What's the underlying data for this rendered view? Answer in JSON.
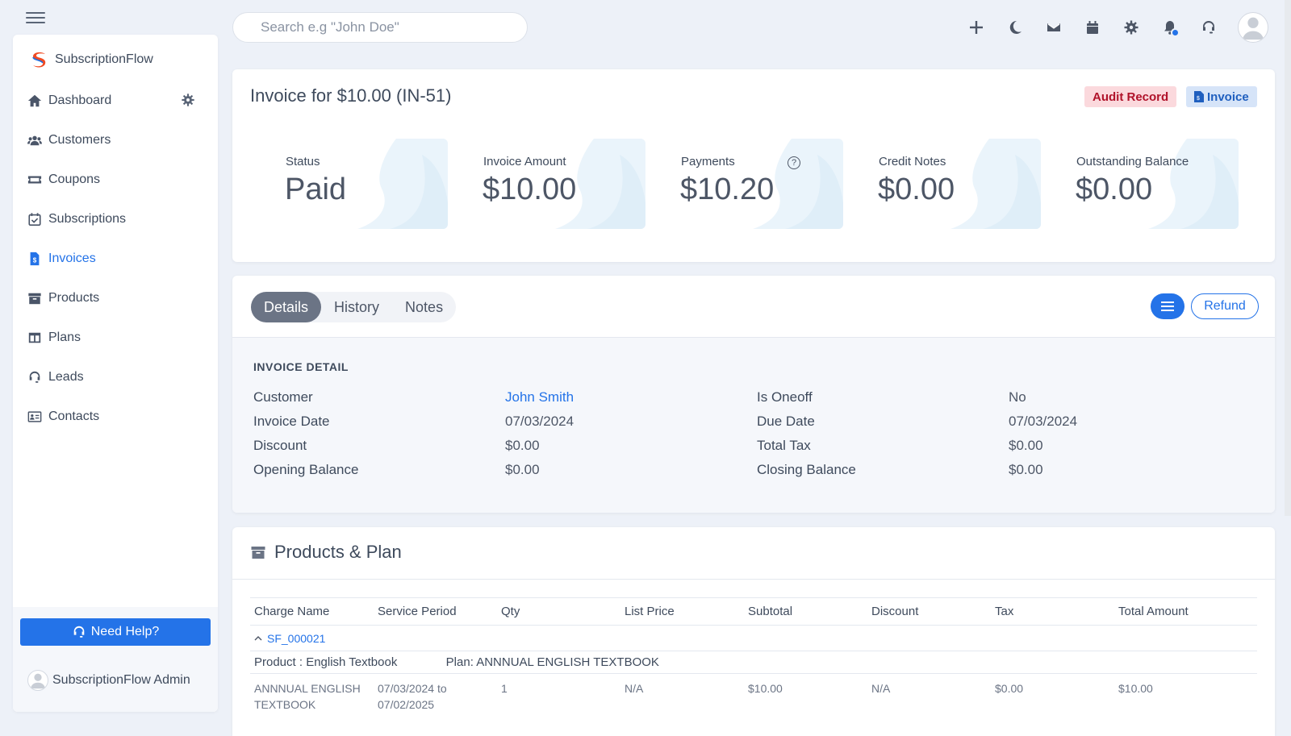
{
  "topbar": {
    "search_placeholder": "Search e.g \"John Doe\"",
    "icons": [
      "plus-icon",
      "moon-icon",
      "mail-icon",
      "calendar-icon",
      "gear-icon",
      "bell-icon",
      "headset-icon",
      "avatar"
    ]
  },
  "sidebar": {
    "brand": "SubscriptionFlow",
    "items": [
      {
        "label": "Dashboard",
        "icon": "home-icon"
      },
      {
        "label": "Customers",
        "icon": "users-icon"
      },
      {
        "label": "Coupons",
        "icon": "ticket-icon"
      },
      {
        "label": "Subscriptions",
        "icon": "calendar-check-icon"
      },
      {
        "label": "Invoices",
        "icon": "invoice-icon"
      },
      {
        "label": "Products",
        "icon": "archive-icon"
      },
      {
        "label": "Plans",
        "icon": "columns-icon"
      },
      {
        "label": "Leads",
        "icon": "headset-icon"
      },
      {
        "label": "Contacts",
        "icon": "id-card-icon"
      }
    ],
    "help_label": "Need Help?",
    "admin_name": "SubscriptionFlow Admin"
  },
  "invoice": {
    "title": "Invoice for $10.00 (IN-51)",
    "badge_audit": "Audit Record",
    "badge_invoice": "Invoice",
    "stats": [
      {
        "label": "Status",
        "value": "Paid"
      },
      {
        "label": "Invoice Amount",
        "value": "$10.00"
      },
      {
        "label": "Payments",
        "value": "$10.20"
      },
      {
        "label": "Credit Notes",
        "value": "$0.00"
      },
      {
        "label": "Outstanding Balance",
        "value": "$0.00"
      }
    ],
    "payments_help": "?"
  },
  "details": {
    "tabs": [
      "Details",
      "History",
      "Notes"
    ],
    "refund_label": "Refund",
    "section_title": "INVOICE DETAIL",
    "left": [
      {
        "label": "Customer",
        "value": "John Smith"
      },
      {
        "label": "Invoice Date",
        "value": "07/03/2024"
      },
      {
        "label": "Discount",
        "value": "$0.00"
      },
      {
        "label": "Opening Balance",
        "value": "$0.00"
      }
    ],
    "right": [
      {
        "label": "Is Oneoff",
        "value": "No"
      },
      {
        "label": "Due Date",
        "value": "07/03/2024"
      },
      {
        "label": "Total Tax",
        "value": "$0.00"
      },
      {
        "label": "Closing Balance",
        "value": "$0.00"
      }
    ]
  },
  "products": {
    "title": "Products & Plan",
    "columns": [
      "Charge Name",
      "Service Period",
      "Qty",
      "List Price",
      "Subtotal",
      "Discount",
      "Tax",
      "Total Amount"
    ],
    "group_id": "SF_000021",
    "product_label": "Product : English Textbook",
    "plan_label": "Plan: ANNNUAL ENGLISH TEXTBOOK",
    "row": {
      "charge_line1": "ANNNUAL ENGLISH",
      "charge_line2": "TEXTBOOK",
      "period_line1": "07/03/2024 to",
      "period_line2": "07/02/2025",
      "qty": "1",
      "list_price": "N/A",
      "subtotal": "$10.00",
      "discount": "N/A",
      "tax": "$0.00",
      "total": "$10.00"
    }
  },
  "colors": {
    "accent": "#2473e8",
    "background": "#edf1f8",
    "audit_badge_bg": "#fbd9dd",
    "audit_badge_text": "#b0122a"
  }
}
